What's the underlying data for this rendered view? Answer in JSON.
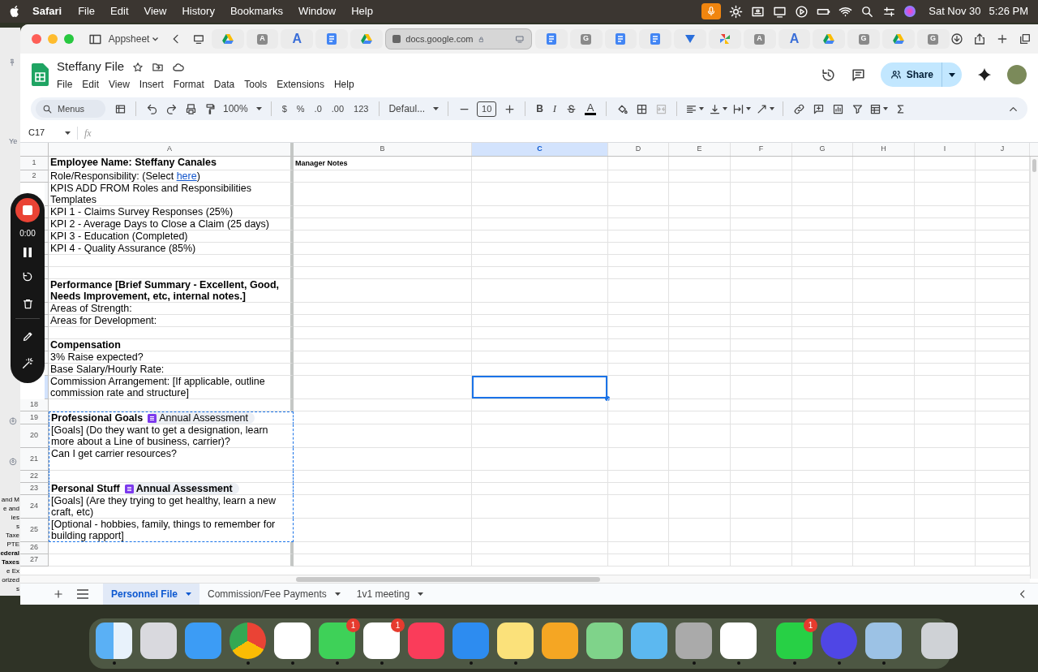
{
  "menu_bar": {
    "app": "Safari",
    "items": [
      "File",
      "Edit",
      "View",
      "History",
      "Bookmarks",
      "Window",
      "Help"
    ],
    "status_icons": [
      {
        "kind": "mic"
      },
      {
        "kind": "gear"
      },
      {
        "kind": "card"
      },
      {
        "kind": "display"
      },
      {
        "kind": "play"
      },
      {
        "kind": "battery"
      },
      {
        "kind": "wifi"
      },
      {
        "kind": "search"
      },
      {
        "kind": "control"
      },
      {
        "kind": "siri"
      }
    ],
    "date": "Sat Nov 30",
    "time": "5:26 PM"
  },
  "background_window": {
    "top_text": "Ye",
    "lines": [
      {
        "text": "and M",
        "bold": false
      },
      {
        "text": "e and",
        "bold": false
      },
      {
        "text": "ies",
        "bold": false
      },
      {
        "text": "s",
        "bold": false
      },
      {
        "text": "Taxe",
        "bold": false
      },
      {
        "text": "PTE",
        "bold": false
      },
      {
        "text": "ederal",
        "bold": true
      },
      {
        "text": "Taxes",
        "bold": true
      },
      {
        "text": "e Ex",
        "bold": false
      },
      {
        "text": "orized",
        "bold": false
      },
      {
        "text": "s",
        "bold": false
      }
    ]
  },
  "browser": {
    "profile": "Appsheet",
    "tabs": [
      {
        "kind": "drive",
        "selected": false
      },
      {
        "kind": "letter",
        "glyph": "A",
        "selected": false
      },
      {
        "kind": "letter-blue",
        "glyph": "A",
        "selected": false
      },
      {
        "kind": "doc",
        "selected": false
      },
      {
        "kind": "drive",
        "selected": false
      },
      {
        "kind": "page",
        "title": "docs.google.com",
        "selected": true
      },
      {
        "kind": "doc",
        "selected": false
      },
      {
        "kind": "letter",
        "glyph": "G",
        "selected": false
      },
      {
        "kind": "doc",
        "selected": false
      },
      {
        "kind": "doc",
        "selected": false
      },
      {
        "kind": "arrow",
        "selected": false
      },
      {
        "kind": "pinwheel",
        "selected": false
      },
      {
        "kind": "letter",
        "glyph": "A",
        "selected": false
      },
      {
        "kind": "letter-blue",
        "glyph": "A",
        "selected": false
      },
      {
        "kind": "drive",
        "selected": false
      },
      {
        "kind": "letter",
        "glyph": "G",
        "selected": false
      },
      {
        "kind": "drive",
        "selected": false
      },
      {
        "kind": "letter",
        "glyph": "G",
        "selected": false
      }
    ]
  },
  "sheets": {
    "title": "Steffany File",
    "menus": [
      "File",
      "Edit",
      "View",
      "Insert",
      "Format",
      "Data",
      "Tools",
      "Extensions",
      "Help"
    ],
    "share": "Share"
  },
  "toolbar": {
    "search": "Menus",
    "zoom": "100%",
    "number_formats": [
      "$",
      "%",
      ".0",
      ".00",
      "123"
    ],
    "font": "Defaul...",
    "font_size": "10",
    "bold": "B",
    "italic": "I",
    "text_color": "A",
    "merge_disabled": true
  },
  "formula_bar": {
    "name_box": "C17",
    "fx": "fx"
  },
  "columns": [
    {
      "label": "A",
      "selected": false
    },
    {
      "label": "B",
      "selected": false
    },
    {
      "label": "C",
      "selected": true
    },
    {
      "label": "D",
      "selected": false
    },
    {
      "label": "E",
      "selected": false
    },
    {
      "label": "F",
      "selected": false
    },
    {
      "label": "G",
      "selected": false
    },
    {
      "label": "H",
      "selected": false
    },
    {
      "label": "I",
      "selected": false
    },
    {
      "label": "J",
      "selected": false
    }
  ],
  "rows": [
    {
      "number": "1",
      "selected": false,
      "in_range": false,
      "bold": true,
      "a": [
        {
          "text": "Employee Name: Steffany Canales"
        }
      ],
      "b": "Manager Notes"
    },
    {
      "number": "2",
      "selected": false,
      "in_range": false,
      "bold": false,
      "a": [
        {
          "text": "Role/Responsibility: (Select "
        },
        {
          "kind": "link",
          "text": "here"
        },
        {
          "text": ")"
        }
      ]
    },
    {
      "selected": false,
      "in_range": false,
      "bold": false,
      "a": [
        {
          "text": "KPIS ADD FROM Roles and Responsibilities Templates"
        }
      ]
    },
    {
      "selected": false,
      "in_range": false,
      "bold": false,
      "a": [
        {
          "text": "KPI 1 - Claims Survey Responses (25%)"
        }
      ]
    },
    {
      "selected": false,
      "in_range": false,
      "bold": false,
      "a": [
        {
          "text": "KPI 2 - Average Days to Close a Claim (25 days)"
        }
      ]
    },
    {
      "selected": false,
      "in_range": false,
      "bold": false,
      "a": [
        {
          "text": "KPI 3 - Education (Completed)"
        }
      ]
    },
    {
      "selected": false,
      "in_range": false,
      "bold": false,
      "a": [
        {
          "text": "KPI 4 - Quality Assurance (85%)"
        }
      ]
    },
    {
      "selected": false,
      "in_range": false,
      "a": []
    },
    {
      "selected": false,
      "in_range": false,
      "a": []
    },
    {
      "selected": false,
      "in_range": false,
      "bold": true,
      "a": [
        {
          "text": "Performance [Brief Summary - Excellent, Good, Needs Improvement, etc, internal notes.]"
        }
      ]
    },
    {
      "selected": false,
      "in_range": false,
      "bold": false,
      "a": [
        {
          "text": "Areas of Strength:"
        }
      ]
    },
    {
      "selected": false,
      "in_range": false,
      "bold": false,
      "a": [
        {
          "text": "Areas for Development:"
        }
      ]
    },
    {
      "selected": false,
      "in_range": false,
      "a": []
    },
    {
      "selected": false,
      "in_range": false,
      "bold": true,
      "a": [
        {
          "text": "Compensation"
        }
      ]
    },
    {
      "selected": false,
      "in_range": false,
      "bold": false,
      "a": [
        {
          "text": "3% Raise expected?"
        }
      ]
    },
    {
      "selected": false,
      "in_range": false,
      "bold": false,
      "a": [
        {
          "text": "Base Salary/Hourly Rate:"
        }
      ]
    },
    {
      "selected": true,
      "in_range": false,
      "bold": false,
      "a": [
        {
          "text": "Commission Arrangement: [If applicable, outline commission rate and structure]"
        }
      ]
    },
    {
      "number": "18",
      "selected": false,
      "in_range": false,
      "a": []
    },
    {
      "number": "19",
      "selected": false,
      "in_range": true,
      "bold": true,
      "a": [
        {
          "text": "Professional Goals"
        },
        {
          "kind": "chip",
          "text": "Annual Assessment",
          "bold": false
        }
      ]
    },
    {
      "number": "20",
      "selected": false,
      "in_range": true,
      "bold": false,
      "a": [
        {
          "text": "[Goals] (Do they want to get a designation, learn more about a Line of business, carrier)?"
        }
      ]
    },
    {
      "number": "21",
      "selected": false,
      "in_range": true,
      "bold": false,
      "tall": true,
      "a": [
        {
          "text": "Can I get carrier resources?"
        }
      ]
    },
    {
      "number": "22",
      "selected": false,
      "in_range": true,
      "a": []
    },
    {
      "number": "23",
      "selected": false,
      "in_range": true,
      "bold": true,
      "a": [
        {
          "text": "Personal Stuff"
        },
        {
          "kind": "chip",
          "text": "Annual Assessment",
          "bold": true
        }
      ]
    },
    {
      "number": "24",
      "selected": false,
      "in_range": true,
      "bold": false,
      "a": [
        {
          "text": "[Goals] (Are they trying to get healthy, learn a new craft, etc)"
        }
      ]
    },
    {
      "number": "25",
      "selected": false,
      "in_range": true,
      "bold": false,
      "a": [
        {
          "text": "[Optional - hobbies, family, things to remember for building rapport]"
        }
      ]
    },
    {
      "number": "26",
      "selected": false,
      "in_range": false,
      "a": []
    },
    {
      "number": "27",
      "selected": false,
      "in_range": false,
      "a": []
    }
  ],
  "sheet_tabs": [
    {
      "label": "Personnel File",
      "selected": true
    },
    {
      "label": "Commission/Fee Payments",
      "selected": false
    },
    {
      "label": "1v1 meeting",
      "selected": false
    }
  ],
  "recorder": {
    "time": "0:00"
  },
  "dock": [
    {
      "kind": "finder",
      "running": true
    },
    {
      "kind": "launchpad",
      "running": false
    },
    {
      "kind": "mail",
      "running": false
    },
    {
      "kind": "chrome",
      "running": true
    },
    {
      "kind": "vector",
      "running": true
    },
    {
      "kind": "messages",
      "running": true,
      "badge": "1"
    },
    {
      "kind": "reminders",
      "running": true,
      "badge": "1"
    },
    {
      "kind": "music",
      "running": false
    },
    {
      "kind": "safari",
      "running": true
    },
    {
      "kind": "notes",
      "running": true
    },
    {
      "kind": "home",
      "running": false
    },
    {
      "kind": "maps",
      "running": false
    },
    {
      "kind": "passwords",
      "running": false
    },
    {
      "kind": "phone",
      "running": true
    },
    {
      "kind": "gmail",
      "running": true
    },
    {
      "kind": "divider"
    },
    {
      "kind": "whatsapp",
      "running": true,
      "badge": "1"
    },
    {
      "kind": "flower",
      "running": true
    },
    {
      "kind": "preview",
      "running": true
    },
    {
      "kind": "divider"
    },
    {
      "kind": "trash",
      "running": false
    }
  ]
}
